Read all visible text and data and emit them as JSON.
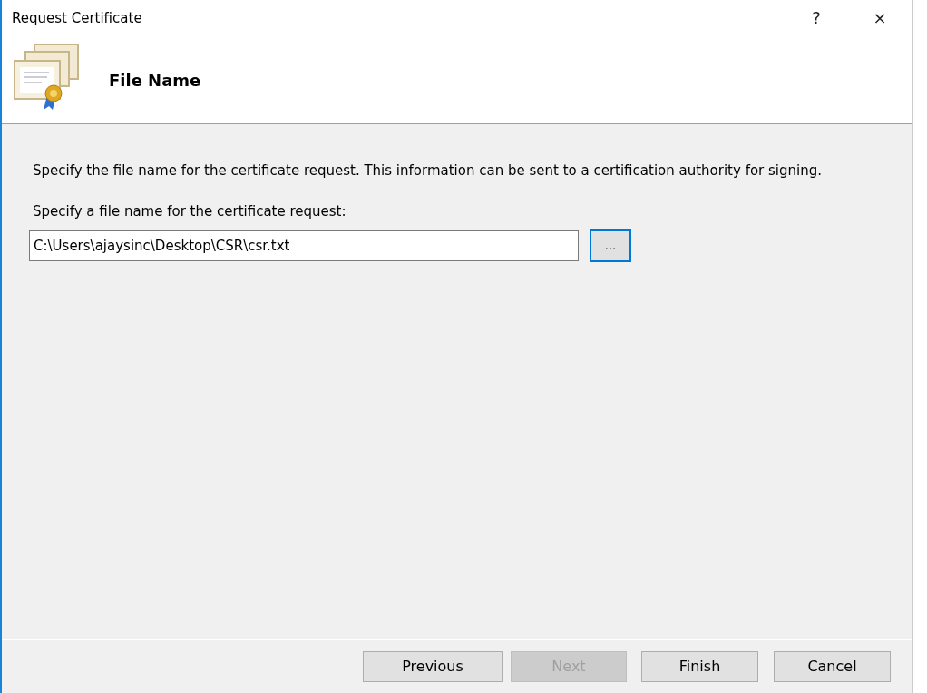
{
  "window": {
    "title": "Request Certificate",
    "help": "?",
    "close": "×"
  },
  "header": {
    "title": "File Name"
  },
  "description": "Specify the file name for the certificate request. This information can be sent to a certification authority for signing.",
  "file_field": {
    "label": "Specify a file name for the certificate request:",
    "value": "C:\\Users\\ajaysinc\\Desktop\\CSR\\csr.txt"
  },
  "browse_button": {
    "label": "...",
    "focused": true
  },
  "buttons": [
    {
      "label": "Previous",
      "disabled": false
    },
    {
      "label": "Next",
      "disabled": true
    },
    {
      "label": "Finish",
      "disabled": false
    },
    {
      "label": "Cancel",
      "disabled": false
    }
  ]
}
